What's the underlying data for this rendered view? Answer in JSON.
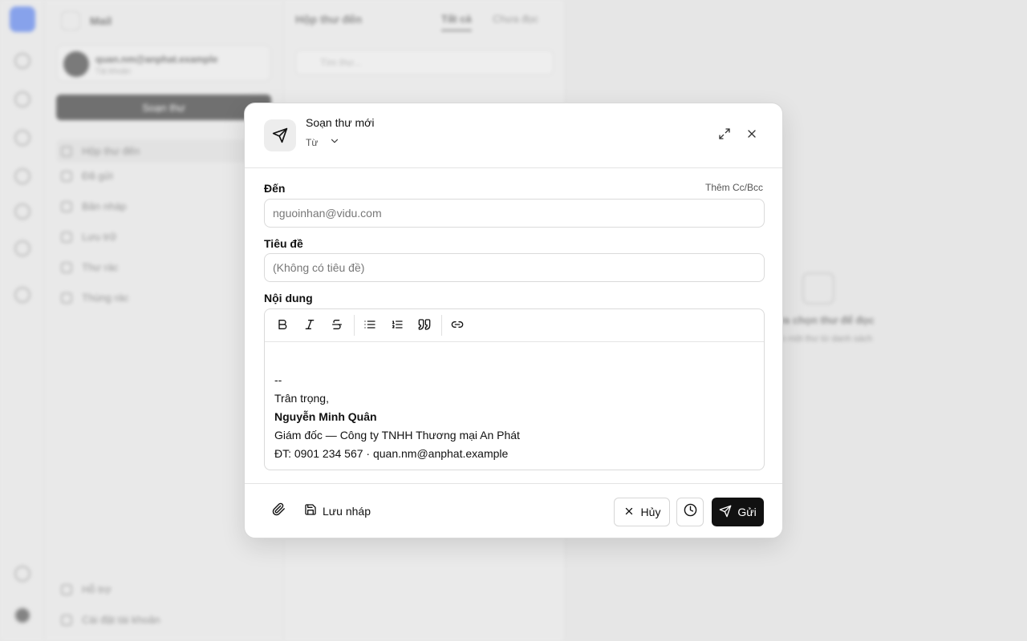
{
  "background": {
    "app_name": "Mail",
    "account": {
      "email": "quan.nm@anphat.example",
      "subtitle": "Tài khoản"
    },
    "compose_label": "Soạn thư",
    "folders": [
      "Hộp thư đến",
      "Đã gửi",
      "Bản nháp",
      "Lưu trữ",
      "Thư rác",
      "Thùng rác"
    ],
    "list_title": "Hộp thư đến",
    "tabs": [
      "Tất cả",
      "Chưa đọc"
    ],
    "search_placeholder": "Tìm thư...",
    "empty_title": "Chưa chọn thư để đọc",
    "empty_subtitle": "Chọn một thư từ danh sách",
    "bottom_items": [
      "Hỗ trợ",
      "Cài đặt tài khoản"
    ]
  },
  "dialog": {
    "title": "Soạn thư mới",
    "from_label": "Từ",
    "to": {
      "label": "Đến",
      "value": "",
      "placeholder": "nguoinhan@vidu.com",
      "cc_bcc_label": "Thêm Cc/Bcc"
    },
    "subject": {
      "label": "Tiêu đề",
      "value": "",
      "placeholder": "(Không có tiêu đề)"
    },
    "body": {
      "label": "Nội dung",
      "signature": {
        "separator": "--",
        "closing": "Trân trọng,",
        "name": "Nguyễn Minh Quân",
        "title": "Giám đốc — Công ty TNHH Thương mại An Phát",
        "contact": "ĐT: 0901 234 567 · quan.nm@anphat.example"
      }
    },
    "toolbar_icons": [
      "bold-icon",
      "italic-icon",
      "strikethrough-icon",
      "bullet-list-icon",
      "numbered-list-icon",
      "quote-icon",
      "link-icon"
    ],
    "footer": {
      "save_draft_label": "Lưu nháp",
      "cancel_label": "Hủy",
      "send_label": "Gửi"
    }
  },
  "colors": {
    "primary_button": "#111111",
    "accent_app": "#3b6cf0",
    "border": "#dadada"
  }
}
